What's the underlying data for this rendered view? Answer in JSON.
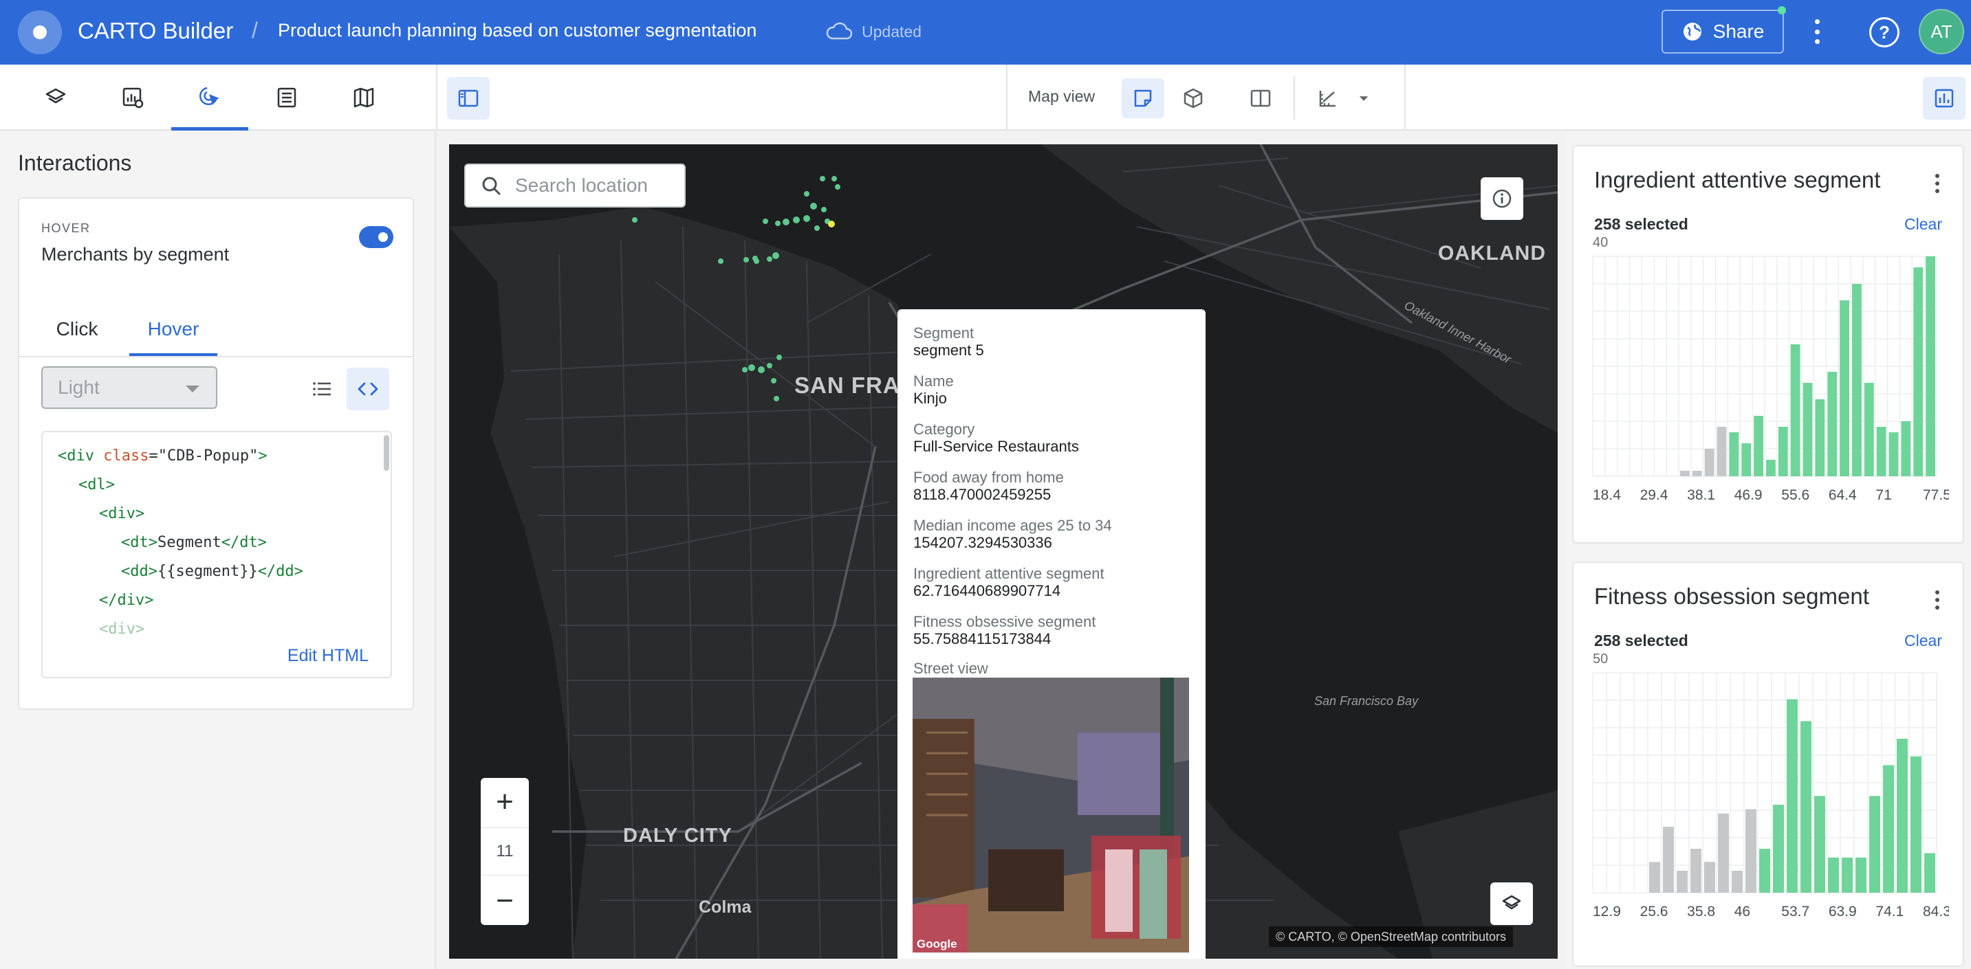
{
  "header": {
    "app_title": "CARTO Builder",
    "separator": "/",
    "map_title": "Product launch planning based on customer segmentation",
    "status": "Updated",
    "share_label": "Share",
    "user_initials": "AT",
    "brand_color": "#2d6ad8"
  },
  "toolbar": {
    "left_tabs": [
      "layers-icon",
      "widgets-settings-icon",
      "interactions-icon",
      "data-table-icon",
      "basemap-icon"
    ],
    "map_view_label": "Map view"
  },
  "interactions": {
    "title": "Interactions",
    "card": {
      "overline": "HOVER",
      "layer_name": "Merchants by segment",
      "tabs": [
        "Click",
        "Hover"
      ],
      "active_tab": "Hover",
      "style_select": "Light",
      "code_lines": [
        "<div class=\"CDB-Popup\">",
        "  <dl>",
        "    <div>",
        "      <dt>Segment</dt>",
        "      <dd>{{segment}}</dd>",
        "    </div>",
        "    <div>"
      ],
      "edit_html_label": "Edit HTML"
    }
  },
  "map": {
    "search_placeholder": "Search location",
    "zoom_level": "11",
    "cities": {
      "oakland": "OAKLAND",
      "san_francisco": "SAN FRA",
      "daly_city": "DALY CITY",
      "colma": "Colma"
    },
    "water_labels": {
      "harbor": "Oakland Inner Harbor",
      "bay": "San Francisco Bay"
    },
    "attribution": "© CARTO, © OpenStreetMap contributors"
  },
  "popup": {
    "fields": [
      {
        "label": "Segment",
        "value": "segment 5"
      },
      {
        "label": "Name",
        "value": "Kinjo"
      },
      {
        "label": "Category",
        "value": "Full-Service Restaurants"
      },
      {
        "label": "Food away from home",
        "value": "8118.470002459255"
      },
      {
        "label": "Median income ages 25 to 34",
        "value": "154207.3294530336"
      },
      {
        "label": "Ingredient attentive segment",
        "value": "62.716440689907714"
      },
      {
        "label": "Fitness obsessive segment",
        "value": "55.75884115173844"
      }
    ],
    "street_view_label": "Street view",
    "street_view_credit": "Google"
  },
  "widgets": [
    {
      "title": "Ingredient attentive segment",
      "selected": "258 selected",
      "clear_label": "Clear",
      "ymax_label": "40"
    },
    {
      "title": "Fitness obsession segment",
      "selected": "258 selected",
      "clear_label": "Clear",
      "ymax_label": "50"
    }
  ],
  "chart_data": [
    {
      "type": "bar",
      "title": "Ingredient attentive segment",
      "x_tick_labels": [
        "18.4",
        "29.4",
        "38.1",
        "46.9",
        "55.6",
        "64.4",
        "71",
        "77.5"
      ],
      "ylim": [
        0,
        40
      ],
      "series": [
        {
          "values": [
            0,
            0,
            0,
            0,
            0,
            0,
            0,
            1,
            1,
            5,
            9,
            8,
            6,
            11,
            3,
            9,
            24,
            17,
            14,
            19,
            32,
            35,
            17,
            9,
            8,
            10,
            38,
            40
          ],
          "highlight_from_index": 11
        }
      ],
      "colors": {
        "selected": "#6fd499",
        "unselected": "#c6c7c9"
      },
      "grid": true
    },
    {
      "type": "bar",
      "title": "Fitness obsession segment",
      "x_tick_labels": [
        "12.9",
        "25.6",
        "35.8",
        "46",
        "53.7",
        "63.9",
        "74.1",
        "84.3"
      ],
      "ylim": [
        0,
        50
      ],
      "series": [
        {
          "values": [
            0,
            0,
            0,
            0,
            7,
            15,
            5,
            10,
            7,
            18,
            5,
            19,
            10,
            20,
            44,
            39,
            22,
            8,
            8,
            8,
            22,
            29,
            35,
            31,
            9
          ],
          "highlight_from_index": 12
        }
      ],
      "colors": {
        "selected": "#6fd499",
        "unselected": "#c6c7c9"
      },
      "grid": true
    }
  ]
}
